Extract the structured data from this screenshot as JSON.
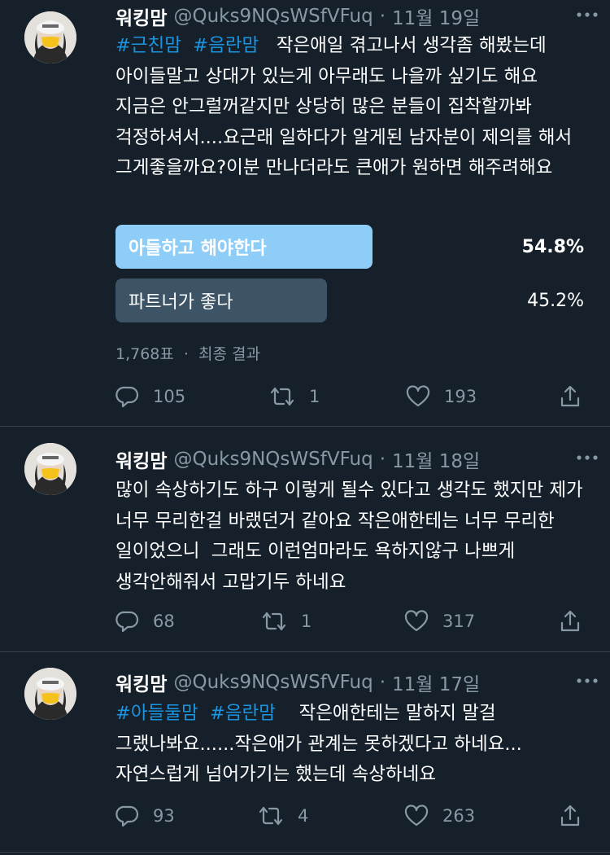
{
  "tweets": [
    {
      "name": "워킹맘",
      "handle": "@Quks9NQsWSfVFuq",
      "dot": "·",
      "date": "11월 19일",
      "hashtags": [
        "#근친맘",
        "#음란맘"
      ],
      "text": "작은애일 겪고나서 생각좀 해봤는데 아이들말고 상대가 있는게 아무래도 나을까 싶기도 해요 지금은 안그럴꺼같지만 상당히 많은 분들이 집착할까봐 걱정하셔서....요근래 일하다가 알게된 남자분이 제의를 해서   그게좋을까요?이분 만나더라도 큰애가 원하면 해주려해요",
      "poll": {
        "options": [
          {
            "label": "아들하고 해야한다",
            "percent": "54.8%",
            "value": 54.8,
            "winner": true
          },
          {
            "label": "파트너가 좋다",
            "percent": "45.2%",
            "value": 45.2,
            "winner": false
          }
        ],
        "votes": "1,768표",
        "dot": "·",
        "status": "최종 결과"
      },
      "replies": "105",
      "retweets": "1",
      "likes": "193"
    },
    {
      "name": "워킹맘",
      "handle": "@Quks9NQsWSfVFuq",
      "dot": "·",
      "date": "11월 18일",
      "text": "많이 속상하기도 하구 이렇게 될수 있다고 생각도 했지만 제가 너무 무리한걸 바랬던거 같아요 작은애한테는 너무 무리한 일이었으니  그래도 이런엄마라도 욕하지않구 나쁘게 생각안해줘서 고맙기두 하네요",
      "replies": "68",
      "retweets": "1",
      "likes": "317"
    },
    {
      "name": "워킹맘",
      "handle": "@Quks9NQsWSfVFuq",
      "dot": "·",
      "date": "11월 17일",
      "hashtags": [
        "#아들둘맘",
        "#음란맘"
      ],
      "text": "작은애한테는 말하지 말걸 그랬나봐요......작은애가 관계는 못하겠다고 하네요...자연스럽게 넘어가기는 했는데 속상하네요",
      "replies": "93",
      "retweets": "4",
      "likes": "263"
    }
  ],
  "colors": {
    "background": "#15202b",
    "secondary_text": "#8899a6",
    "hashtag": "#1b95e0",
    "poll_winner": "#8ecdf8",
    "poll_other": "#3d5466",
    "divider": "#38444d"
  },
  "icons": [
    "more-icon",
    "reply-icon",
    "retweet-icon",
    "like-icon",
    "share-icon"
  ]
}
